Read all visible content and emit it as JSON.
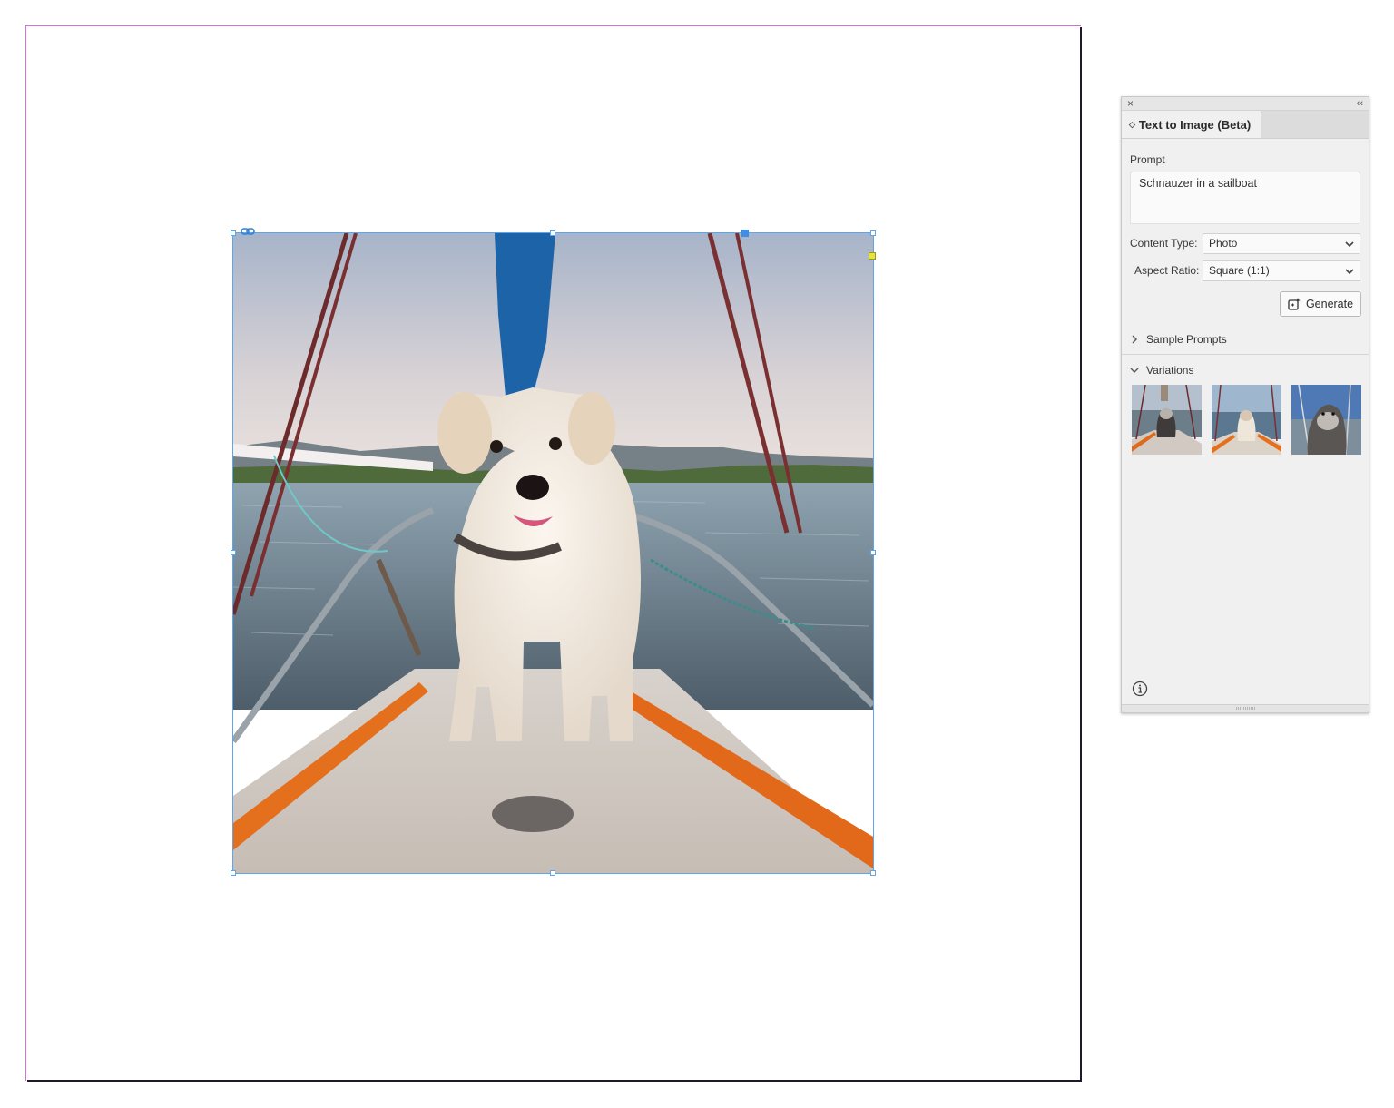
{
  "panel": {
    "close_glyph": "×",
    "collapse_glyph": "‹‹",
    "tab_label": "Text to Image (Beta)",
    "prompt_label": "Prompt",
    "prompt_value": "Schnauzer in a sailboat",
    "content_type_label": "Content Type:",
    "content_type_value": "Photo",
    "aspect_ratio_label": "Aspect Ratio:",
    "aspect_ratio_value": "Square (1:1)",
    "generate_label": "Generate",
    "sample_prompts_label": "Sample Prompts",
    "variations_label": "Variations",
    "variations": [
      {
        "icon": "variation-thumbnail-1"
      },
      {
        "icon": "variation-thumbnail-2"
      },
      {
        "icon": "variation-thumbnail-3"
      }
    ]
  },
  "canvas": {
    "page_margin_color": "#d76fd7",
    "frame_color": "#5fa6e8",
    "image_icon": "schnauzer-on-sailboat-photo"
  }
}
